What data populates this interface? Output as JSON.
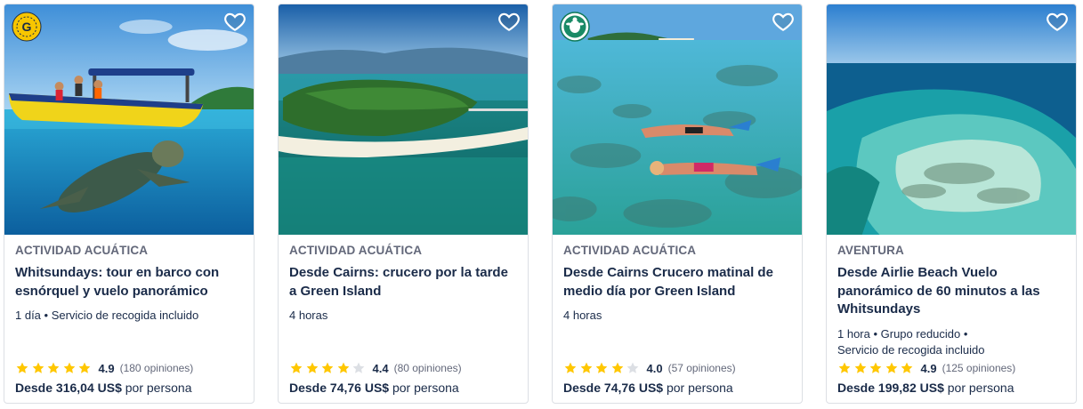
{
  "cards": [
    {
      "category": "ACTIVIDAD ACUÁTICA",
      "title": "Whitsundays: tour en barco con esnórquel y vuelo panorámico",
      "meta_lines": [
        "1 día • Servicio de recogida incluido"
      ],
      "rating": 4.9,
      "rating_text": "4.9",
      "reviews": "(180 opiniones)",
      "price_prefix": "Desde",
      "price": "316,04 US$",
      "price_suffix": "por persona",
      "badge": "gold-g-badge",
      "image": "boat-with-sea-turtle"
    },
    {
      "category": "ACTIVIDAD ACUÁTICA",
      "title": "Desde Cairns: crucero por la tarde a Green Island",
      "meta_lines": [
        "4 horas"
      ],
      "rating": 4.4,
      "rating_text": "4.4",
      "reviews": "(80 opiniones)",
      "price_prefix": "Desde",
      "price": "74,76 US$",
      "price_suffix": "por persona",
      "badge": null,
      "image": "green-island-aerial"
    },
    {
      "category": "ACTIVIDAD ACUÁTICA",
      "title": "Desde Cairns Crucero matinal de medio día por Green Island",
      "meta_lines": [
        "4 horas"
      ],
      "rating": 4.0,
      "rating_text": "4.0",
      "reviews": "(57 opiniones)",
      "price_prefix": "Desde",
      "price": "74,76 US$",
      "price_suffix": "por persona",
      "badge": "eco-turtle-badge",
      "image": "snorkelers-on-reef"
    },
    {
      "category": "AVENTURA",
      "title": "Desde Airlie Beach Vuelo panorámico de 60 minutos a las Whitsundays",
      "meta_lines": [
        "1 hora • Grupo reducido •",
        "Servicio de recogida incluido"
      ],
      "rating": 4.9,
      "rating_text": "4.9",
      "reviews": "(125 opiniones)",
      "price_prefix": "Desde",
      "price": "199,82 US$",
      "price_suffix": "por persona",
      "badge": null,
      "image": "reef-aerial"
    }
  ],
  "colors": {
    "text": "#1a2b49",
    "muted": "#63687a",
    "star": "#ffc700",
    "star_empty": "#dcdfe4",
    "border": "#dcdfe4"
  },
  "icons": {
    "wishlist": "heart-outline-icon",
    "rating": "star-icon"
  }
}
